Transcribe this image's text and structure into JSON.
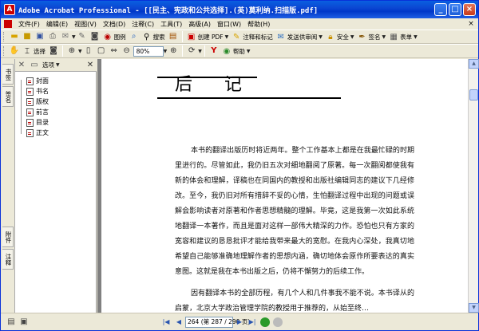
{
  "window": {
    "app_icon_letter": "A",
    "title": "Adobe Acrobat Professional - [[民主、宪政和公共选择].(英)莫利纳.扫描版.pdf]",
    "controls": {
      "minimize": "_",
      "maximize": "□",
      "close": "×"
    }
  },
  "menubar": {
    "items": [
      "文件(F)",
      "编辑(E)",
      "视图(V)",
      "文档(D)",
      "注释(C)",
      "工具(T)",
      "高级(A)",
      "窗口(W)",
      "帮助(H)"
    ],
    "close_glyph": "×"
  },
  "toolbar1": {
    "create_pdf": "创建 PDF",
    "comment": "注释和标记",
    "send_review": "发送供审阅",
    "security": "安全",
    "sign": "签名",
    "form": "表单",
    "print_label": "图例",
    "search_label": "搜索"
  },
  "toolbar2": {
    "select_label": "选择",
    "zoom_value": "80%",
    "help_label": "帮助"
  },
  "leftpanel": {
    "tabs": [
      "书签",
      "签名",
      "附件",
      "注释"
    ],
    "options_label": "选项",
    "bookmarks": [
      "封面",
      "书名",
      "版权",
      "前言",
      "目录",
      "正文"
    ]
  },
  "document": {
    "heading": "后记",
    "paragraphs": [
      "本书的翻译出版历时将近两年。整个工作基本上都是在我最忙碌的时期里进行的。尽管如此，我仍旧五次对细地翻阅了原著。每一次翻阅都使我有新的体会和理解，译稿也在同国内的教授和出版社编辑同志的建议下几经修改。至今，我仍旧对所有措辞不妥的心情，生怕翻译过程中出现的问题或误解会影响读者对原著和作者思想精髓的理解。毕竟，这是我第一次如此系统地翻译一本著作，而且是面对这样一部伟大精深的力作。恐怕也只有方家的宽容和建议的恳恳批评才能给我带来最大的宽慰。在我内心深处，我真切地希望自己能够准确地理解作者的思想内涵，确切地体会原作所要表达的真实意图。这就是我在本书出版之后，仍将不懈努力的后续工作。",
      "因有翻译本书的全部历程，有几个人和几件事我不能不说。本书译从的启蒙，北京大学政治管理学院的教授用于推荐的，从始至终…"
    ]
  },
  "statusbar": {
    "page_display": "264 (第 287 / 290 页)"
  }
}
